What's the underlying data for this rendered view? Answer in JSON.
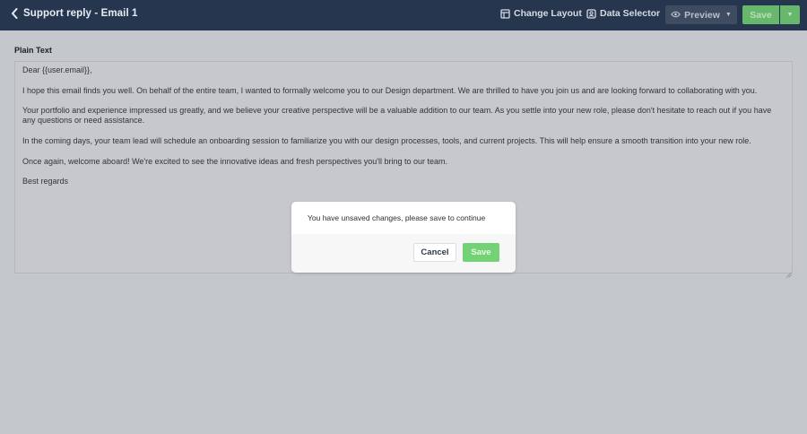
{
  "header": {
    "title": "Support reply - Email 1",
    "back_icon": "chevron-left-icon",
    "change_layout_label": "Change Layout",
    "change_layout_icon": "layout-icon",
    "data_selector_label": "Data Selector",
    "data_selector_icon": "data-selector-icon",
    "preview_label": "Preview",
    "preview_icon": "eye-icon",
    "save_label": "Save",
    "save_dropdown_icon": "caret-down-icon"
  },
  "editor": {
    "section_label": "Plain Text",
    "lines": [
      "Dear {{user.email}},",
      "I hope this email finds you well. On behalf of the entire team, I wanted to formally welcome you to our Design department. We are thrilled to have you join us and are looking forward to collaborating with you.",
      "Your portfolio and experience impressed us greatly, and we believe your creative perspective will be a valuable addition to our team. As you settle into your new role, please don't hesitate to reach out if you have any questions or need assistance.",
      "In the coming days, your team lead will schedule an onboarding session to familiarize you with our design processes, tools, and current projects. This will help ensure a smooth transition into your new role.",
      "Once again, welcome aboard! We're excited to see the innovative ideas and fresh perspectives you'll bring to our team.",
      "Best regards"
    ]
  },
  "modal": {
    "message": "You have unsaved changes, please save to continue",
    "cancel_label": "Cancel",
    "save_label": "Save"
  },
  "colors": {
    "header_bg": "#26364f",
    "overlay_bg": "#c4c7cc",
    "save_green": "#72d275",
    "preview_bg": "#3f4b60"
  }
}
